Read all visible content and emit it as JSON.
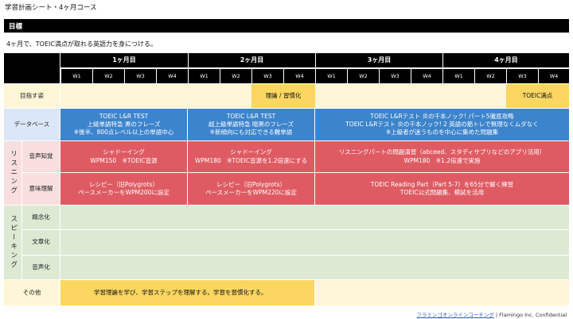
{
  "title": "学習計画シート・4ヶ月コース",
  "section": "目標",
  "goal": "4ヶ月で、TOEIC満点が取れる英語力を身につける。",
  "months": [
    "1ヶ月目",
    "2ヶ月目",
    "3ヶ月目",
    "4ヶ月目"
  ],
  "week_labels": [
    "W1",
    "W2",
    "W3",
    "W4"
  ],
  "rows": {
    "target": {
      "label": "目指す姿",
      "m2_w3w4": "理論 / 習慣化",
      "m4_w4": "TOEIC満点"
    },
    "database": {
      "label": "データベース",
      "m1": [
        "TOEIC L&R TEST",
        "上級単語特急 黒のフレーズ",
        "※後半、800点レベル以上の単語中心"
      ],
      "m2": [
        "TOEIC L&R TEST",
        "超上級単語特急 暗黒のフレーズ",
        "※新傾向にも対応できる難単語"
      ],
      "m3m4": [
        "TOEIC L&Rテスト 炎の千本ノック! パート5徹底攻略",
        "TOEIC L&Rテスト 炎の千本ノック! 2 英語の筋トレで無理なくムダなく",
        "※上級者が迷うものを中心に集めた問題集"
      ]
    },
    "listening": {
      "group": "リスニング",
      "phonetic": {
        "label": "音声知覚",
        "m1": [
          "シャドーイング",
          "WPM150　※TOEIC音源"
        ],
        "m2": [
          "シャドーイング",
          "WPM180　※TOEIC音源を1.2倍速にする"
        ],
        "m3m4": [
          "リスニングパートの問題演習（abceed、スタディサプリなどのアプリ活用）",
          "WPM180　※1.2倍速で実施"
        ]
      },
      "meaning": {
        "label": "意味理解",
        "m1": [
          "レシピー（旧Polygrots）",
          "ペースメーカーをWPM200に設定"
        ],
        "m2": [
          "レシピー（旧Polygrots）",
          "ペースメーカーをWPM220に設定"
        ],
        "m3m4": [
          "TOEIC Reading Part（Part 5-7）を65分で解く練習",
          "TOEIC公式問題集、模試を活用"
        ]
      }
    },
    "speaking": {
      "group": "スピーキング",
      "labels": [
        "概念化",
        "文章化",
        "音声化"
      ]
    },
    "other": {
      "label": "その他",
      "m1m2": "学習理論を学び、学習ステップを理解する。学習を習慣化する。"
    }
  },
  "footer": {
    "link": "フラミンゴオンラインコーチング",
    "suffix": " | Flamingo Inc. Confidential"
  },
  "colors": {
    "yellow": "#fbd661",
    "blue": "#3c84cc",
    "red": "#df5b63",
    "green_light": "#dcead4"
  }
}
